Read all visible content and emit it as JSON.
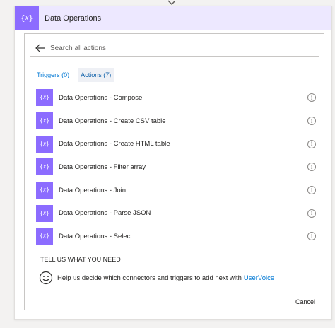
{
  "header": {
    "title": "Data Operations",
    "icon": "curly-brace-icon"
  },
  "search": {
    "placeholder": "Search all actions",
    "value": ""
  },
  "tabs": [
    {
      "label": "Triggers (0)",
      "active": false
    },
    {
      "label": "Actions (7)",
      "active": true
    }
  ],
  "actions": [
    {
      "label": "Data Operations - Compose"
    },
    {
      "label": "Data Operations - Create CSV table"
    },
    {
      "label": "Data Operations - Create HTML table"
    },
    {
      "label": "Data Operations - Filter array"
    },
    {
      "label": "Data Operations - Join"
    },
    {
      "label": "Data Operations - Parse JSON"
    },
    {
      "label": "Data Operations - Select"
    }
  ],
  "feedback": {
    "heading": "TELL US WHAT YOU NEED",
    "text": "Help us decide which connectors and triggers to add next with",
    "link": "UserVoice"
  },
  "footer": {
    "cancel_label": "Cancel"
  },
  "colors": {
    "accent": "#8c6cff",
    "header_bg": "#ede8ff",
    "link": "#0078d4"
  }
}
